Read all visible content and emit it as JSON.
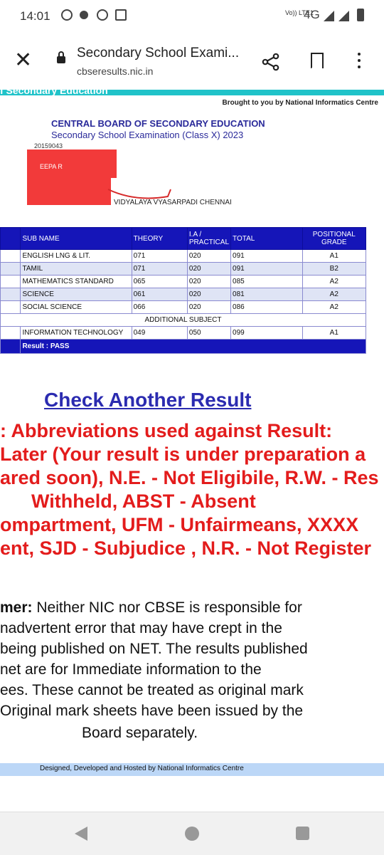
{
  "status_bar": {
    "time": "14:01",
    "volte": "Vo)) LTE1",
    "network": "4G"
  },
  "browser": {
    "title": "Secondary School Exami...",
    "url": "cbseresults.nic.in"
  },
  "page": {
    "top_strip_text": "f Secondary Education",
    "brought_by": "Brought to you by National Informatics Centre",
    "board_name": "CENTRAL BOARD OF SECONDARY EDUCATION",
    "exam_name": "Secondary School Examination (Class X) 2023",
    "roll_no_fragment": "20159043",
    "name_fragment": "EEPA R",
    "school_fragment": "VIDYALAYA VYASARPADI CHENNAI"
  },
  "results_table": {
    "headers": [
      "SUB NAME",
      "THEORY",
      "I.A / PRACTICAL",
      "TOTAL",
      "POSITIONAL GRADE"
    ],
    "rows": [
      [
        "ENGLISH LNG & LIT.",
        "071",
        "020",
        "091",
        "A1"
      ],
      [
        "TAMIL",
        "071",
        "020",
        "091",
        "B2"
      ],
      [
        "MATHEMATICS STANDARD",
        "065",
        "020",
        "085",
        "A2"
      ],
      [
        "SCIENCE",
        "061",
        "020",
        "081",
        "A2"
      ],
      [
        "SOCIAL SCIENCE",
        "066",
        "020",
        "086",
        "A2"
      ]
    ],
    "additional_label": "ADDITIONAL SUBJECT",
    "additional_row": [
      "INFORMATION TECHNOLOGY",
      "049",
      "050",
      "099",
      "A1"
    ],
    "result_label": "Result :",
    "result_value": "PASS"
  },
  "check_link": "Check Another Result",
  "abbreviations": [
    ": Abbreviations used against Result:",
    "Later (Your result is under preparation a",
    "ared soon), N.E. - Not Eligibile, R.W. - Res",
    "Withheld, ABST - Absent",
    "ompartment, UFM - Unfairmeans, XXXX",
    "ent, SJD - Subjudice , N.R. - Not Register"
  ],
  "disclaimer": {
    "label": "mer:",
    "lines": [
      " Neither NIC nor CBSE is responsible for",
      "nadvertent error that may have crept in the",
      "being published on NET. The results published",
      " net are for Immediate information to the",
      "ees. These cannot be treated as original mark",
      " Original mark sheets have been issued by the",
      "Board separately."
    ]
  },
  "footer": "Designed, Developed and Hosted by National Informatics Centre",
  "colors": {
    "header_blue": "#1515b8",
    "link_blue": "#2b2bb0",
    "abbr_red": "#e31c1c",
    "strip_teal": "#20c3c9",
    "footer_blue": "#bcd7f7"
  }
}
